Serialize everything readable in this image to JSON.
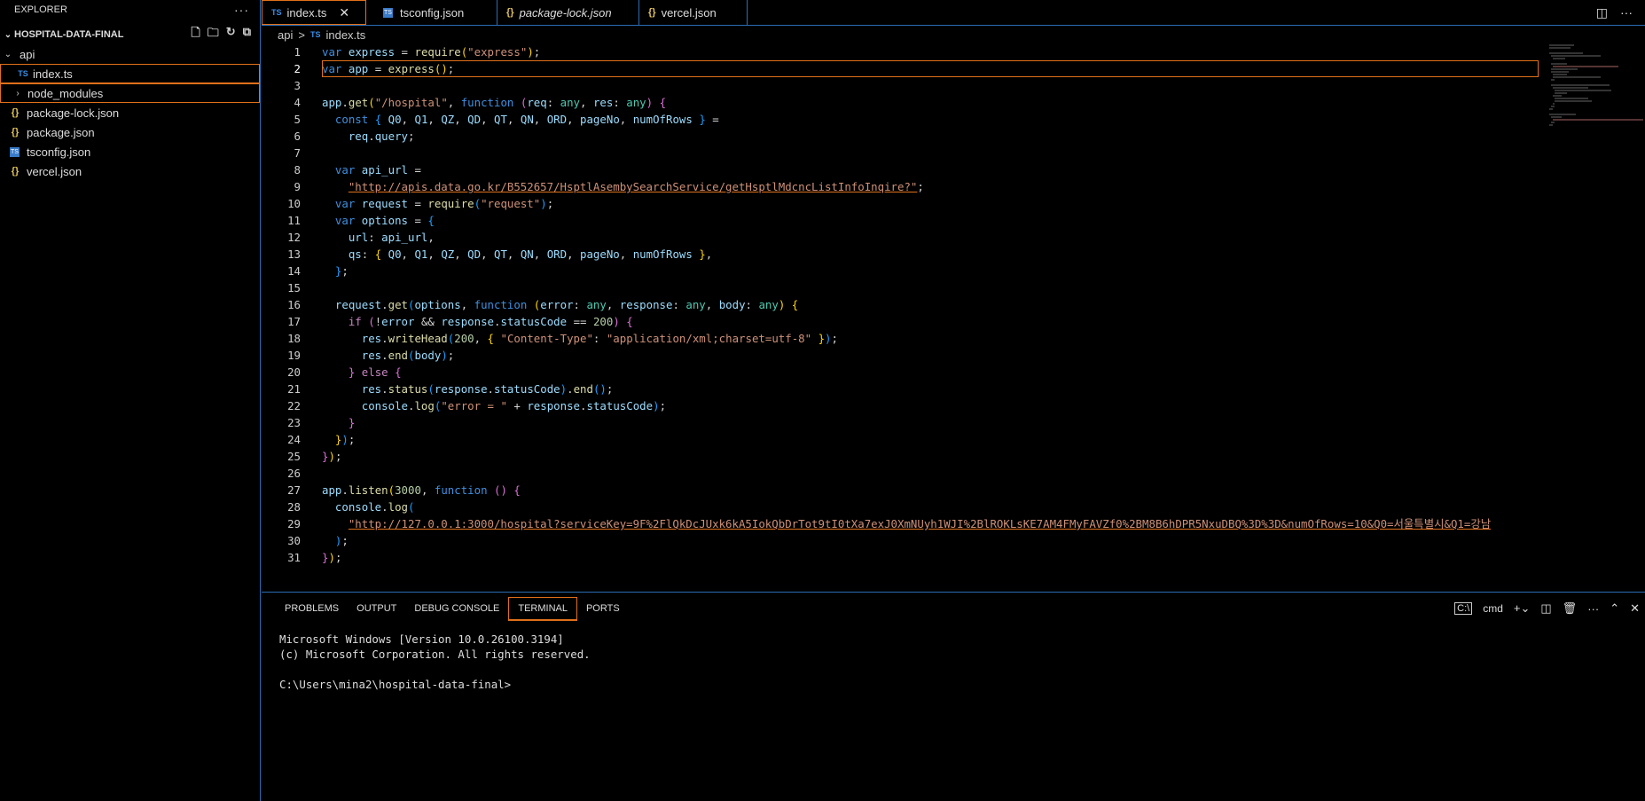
{
  "explorer": {
    "title": "EXPLORER",
    "more": "···",
    "folder": "HOSPITAL-DATA-FINAL",
    "items": [
      {
        "label": "api",
        "kind": "folder-open"
      },
      {
        "label": "index.ts",
        "kind": "ts"
      },
      {
        "label": "node_modules",
        "kind": "folder"
      },
      {
        "label": "package-lock.json",
        "kind": "json"
      },
      {
        "label": "package.json",
        "kind": "json"
      },
      {
        "label": "tsconfig.json",
        "kind": "tsconfig"
      },
      {
        "label": "vercel.json",
        "kind": "json"
      }
    ]
  },
  "tabs": [
    {
      "label": "index.ts",
      "icon": "TS"
    },
    {
      "label": "tsconfig.json",
      "icon": "TS"
    },
    {
      "label": "package-lock.json",
      "icon": "{}"
    },
    {
      "label": "vercel.json",
      "icon": "{}"
    }
  ],
  "breadcrumb": {
    "folder": "api",
    "sep": ">",
    "icon": "TS",
    "file": "index.ts"
  },
  "code": {
    "line_numbers": [
      "1",
      "2",
      "3",
      "4",
      "5",
      "6",
      "7",
      "8",
      "9",
      "10",
      "11",
      "12",
      "13",
      "14",
      "15",
      "16",
      "17",
      "18",
      "19",
      "20",
      "21",
      "22",
      "23",
      "24",
      "25",
      "26",
      "27",
      "28",
      "29",
      "30",
      "31"
    ],
    "url1": "\"http://apis.data.go.kr/B552657/HsptlAsembySearchService/getHsptlMdcncListInfoInqire?\"",
    "url2": "\"http://127.0.0.1:3000/hospital?serviceKey=9F%2FlQkDcJUxk6kA5IokQbDrTot9tI0tXa7exJ0XmNUyh1WJI%2BlROKLsKE7AM4FMyFAVZf0%2BM8B6hDPR5NxuDBQ%3D%3D&numOfRows=10&Q0=서울특별시&Q1=강남"
  },
  "panel": {
    "tabs": [
      "PROBLEMS",
      "OUTPUT",
      "DEBUG CONSOLE",
      "TERMINAL",
      "PORTS"
    ],
    "shell": "cmd",
    "terminal_lines": [
      "Microsoft Windows [Version 10.0.26100.3194]",
      "(c) Microsoft Corporation. All rights reserved.",
      "",
      "C:\\Users\\mina2\\hospital-data-final>"
    ]
  }
}
